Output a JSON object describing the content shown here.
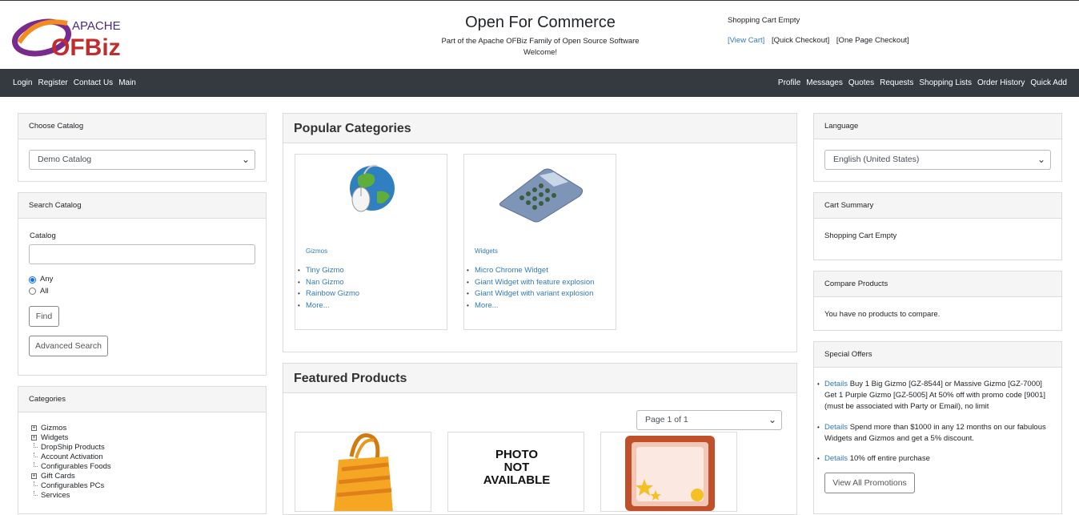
{
  "header": {
    "logo_top": "APACHE",
    "logo_main": "OFBiz",
    "title": "Open For Commerce",
    "subtitle": "Part of the Apache OFBiz Family of Open Source Software",
    "welcome": "Welcome!",
    "cart_status": "Shopping Cart Empty",
    "view_cart": "[View Cart]",
    "quick_checkout": "[Quick Checkout]",
    "one_page_checkout": "[One Page Checkout]"
  },
  "nav": {
    "left": [
      "Login",
      "Register",
      "Contact Us",
      "Main"
    ],
    "right": [
      "Profile",
      "Messages",
      "Quotes",
      "Requests",
      "Shopping Lists",
      "Order History",
      "Quick Add"
    ]
  },
  "choose_catalog": {
    "title": "Choose Catalog",
    "selected": "Demo Catalog"
  },
  "search_catalog": {
    "title": "Search Catalog",
    "catalog_label": "Catalog",
    "any_label": "Any",
    "all_label": "All",
    "find_button": "Find",
    "advanced_button": "Advanced Search"
  },
  "categories": {
    "title": "Categories",
    "items": [
      {
        "label": "Gizmos",
        "expandable": true
      },
      {
        "label": "Widgets",
        "expandable": true
      },
      {
        "label": "DropShip Products",
        "expandable": false
      },
      {
        "label": "Account Activation",
        "expandable": false
      },
      {
        "label": "Configurables Foods",
        "expandable": false
      },
      {
        "label": "Gift Cards",
        "expandable": true
      },
      {
        "label": "Configurables PCs",
        "expandable": false
      },
      {
        "label": "Services",
        "expandable": false
      }
    ]
  },
  "popular": {
    "title": "Popular Categories",
    "cats": [
      {
        "name": "Gizmos",
        "items": [
          "Tiny Gizmo",
          "Nan Gizmo",
          "Rainbow Gizmo",
          "More..."
        ]
      },
      {
        "name": "Widgets",
        "items": [
          "Micro Chrome Widget",
          "Giant Widget with feature explosion",
          "Giant Widget with variant explosion",
          "More..."
        ]
      }
    ]
  },
  "featured": {
    "title": "Featured Products",
    "page_select": "Page 1 of 1",
    "photo_na": [
      "PHOTO",
      "NOT",
      "AVAILABLE"
    ]
  },
  "language": {
    "title": "Language",
    "selected": "English (United States)"
  },
  "cart_summary": {
    "title": "Cart Summary",
    "text": "Shopping Cart Empty"
  },
  "compare": {
    "title": "Compare Products",
    "text": "You have no products to compare."
  },
  "special_offers": {
    "title": "Special Offers",
    "details_label": "Details",
    "offers": [
      "Buy 1 Big Gizmo [GZ-8544] or Massive Gizmo [GZ-7000] Get 1 Purple Gizmo [GZ-5005] At 50% off with promo code [9001] (must be associated with Party or Email), no limit",
      "Spend more than $1000 in any 12 months on our fabulous Widgets and Gizmos and get a 5% discount.",
      "10% off entire purchase"
    ],
    "view_all": "View All Promotions"
  }
}
